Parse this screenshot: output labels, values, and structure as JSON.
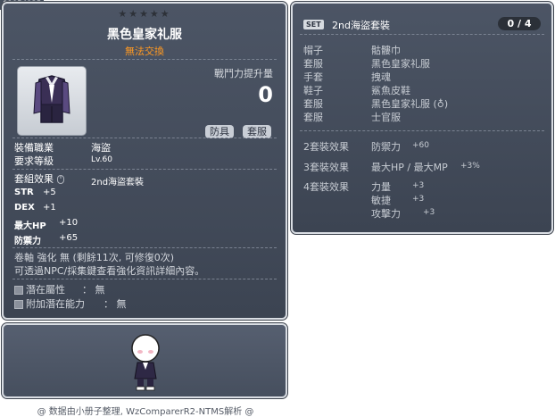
{
  "item_id": "01054125",
  "item": {
    "stars": "★★★★★",
    "name": "黑色皇家礼服",
    "trade_status": "無法交換",
    "attack_increase_label": "戰鬥力提升量",
    "attack_increase_value": "0",
    "tags": [
      "防具",
      "套服"
    ],
    "job_label": "裝備職業",
    "job_value": "海盜",
    "level_label": "要求等級",
    "level_value": "Lv.60",
    "set_effect_label": "套組效果",
    "set_name": "2nd海盜套裝",
    "stats": [
      {
        "name": "STR",
        "value": "+5"
      },
      {
        "name": "DEX",
        "value": "+1"
      },
      {
        "name": "最大HP",
        "value": "+10"
      },
      {
        "name": "防禦力",
        "value": "+65"
      }
    ],
    "enhance_text": "卷軸 強化 無 (剩餘11次, 可修復0次)",
    "npc_text": "可透過NPC/採集鍵查看強化資訊詳細內容。",
    "potential_label": "潛在屬性",
    "potential_value": "： 無",
    "additional_potential_label": "附加潛在能力",
    "additional_potential_value": "： 無"
  },
  "set": {
    "badge": "SET",
    "title": "2nd海盜套裝",
    "count": "0 / 4",
    "parts": [
      {
        "slot": "帽子",
        "name": "骷髏巾"
      },
      {
        "slot": "套服",
        "name": "黑色皇家礼服"
      },
      {
        "slot": "手套",
        "name": "拽魂"
      },
      {
        "slot": "鞋子",
        "name": "鯊魚皮鞋"
      },
      {
        "slot": "套服",
        "name": "黑色皇家礼服 (♁)"
      },
      {
        "slot": "套服",
        "name": "士官服"
      }
    ],
    "bonuses": [
      {
        "label": "2套裝效果",
        "lines": [
          {
            "stat": "防禦力",
            "value": "+60"
          }
        ]
      },
      {
        "label": "3套裝效果",
        "lines": [
          {
            "stat": "最大HP / 最大MP",
            "value": "+3%"
          }
        ]
      },
      {
        "label": "4套裝效果",
        "lines": [
          {
            "stat": "力量",
            "value": "+3"
          },
          {
            "stat": "敏捷",
            "value": "+3"
          },
          {
            "stat": "攻擊力",
            "value": "+3"
          }
        ]
      }
    ]
  },
  "footer": "@ 数据由小册子整理, WzComparerR2-NTMS解析 @",
  "colors": {
    "panel_bg": "#444c5a",
    "trade_status": "#ff9922",
    "panel_border": "#d9dde3"
  }
}
